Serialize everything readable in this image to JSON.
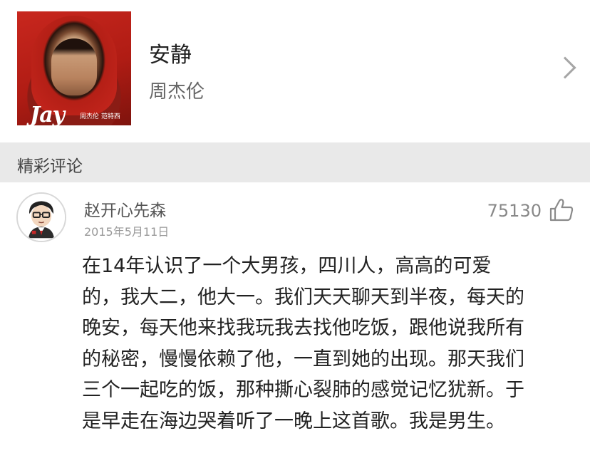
{
  "song": {
    "title": "安静",
    "artist": "周杰伦",
    "album_cover_logo": "Jay",
    "album_cover_subtitle": "周杰伦 范特西"
  },
  "section": {
    "title": "精彩评论"
  },
  "comment": {
    "username": "赵开心先森",
    "date": "2015年5月11日",
    "likes": "75130",
    "lines": [
      "在14年认识了一个大男孩，四川人，高高的可爱",
      "的，我大二，他大一。我们天天聊天到半夜，每天的",
      "晚安，每天他来找我玩我去找他吃饭，跟他说我所有",
      "的秘密，慢慢依赖了他，一直到她的出现。那天我们",
      "三个一起吃的饭，那种撕心裂肺的感觉记忆犹新。于",
      "是早走在海边哭着听了一晚上这首歌。我是男生。"
    ]
  },
  "icons": {
    "chevron": "chevron-right-icon",
    "like": "thumbs-up-icon",
    "avatar": "cartoon-avatar"
  }
}
